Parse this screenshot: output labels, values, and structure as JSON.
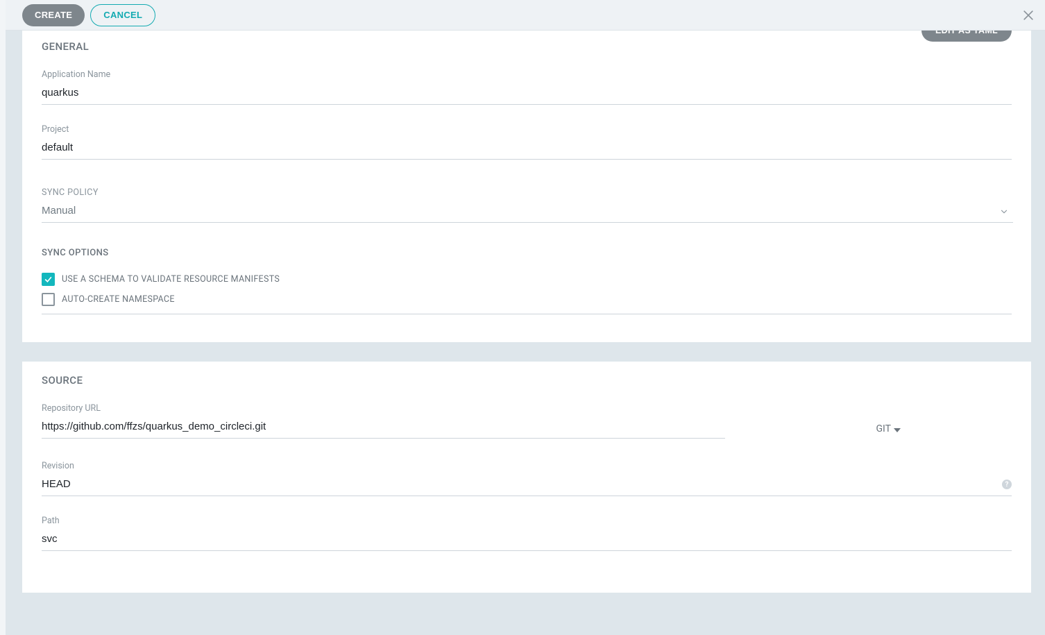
{
  "topbar": {
    "create_label": "CREATE",
    "cancel_label": "CANCEL",
    "edit_yaml_label": "EDIT AS YAML"
  },
  "general": {
    "title": "GENERAL",
    "app_name_label": "Application Name",
    "app_name_value": "quarkus",
    "project_label": "Project",
    "project_value": "default",
    "sync_policy_label": "SYNC POLICY",
    "sync_policy_value": "Manual",
    "sync_options_label": "SYNC OPTIONS",
    "opt_schema_label": "USE A SCHEMA TO VALIDATE RESOURCE MANIFESTS",
    "opt_schema_checked": true,
    "opt_autons_label": "AUTO-CREATE NAMESPACE",
    "opt_autons_checked": false
  },
  "source": {
    "title": "SOURCE",
    "repo_url_label": "Repository URL",
    "repo_url_value": "https://github.com/ffzs/quarkus_demo_circleci.git",
    "repo_type_label": "GIT",
    "revision_label": "Revision",
    "revision_value": "HEAD",
    "path_label": "Path",
    "path_value": "svc"
  }
}
